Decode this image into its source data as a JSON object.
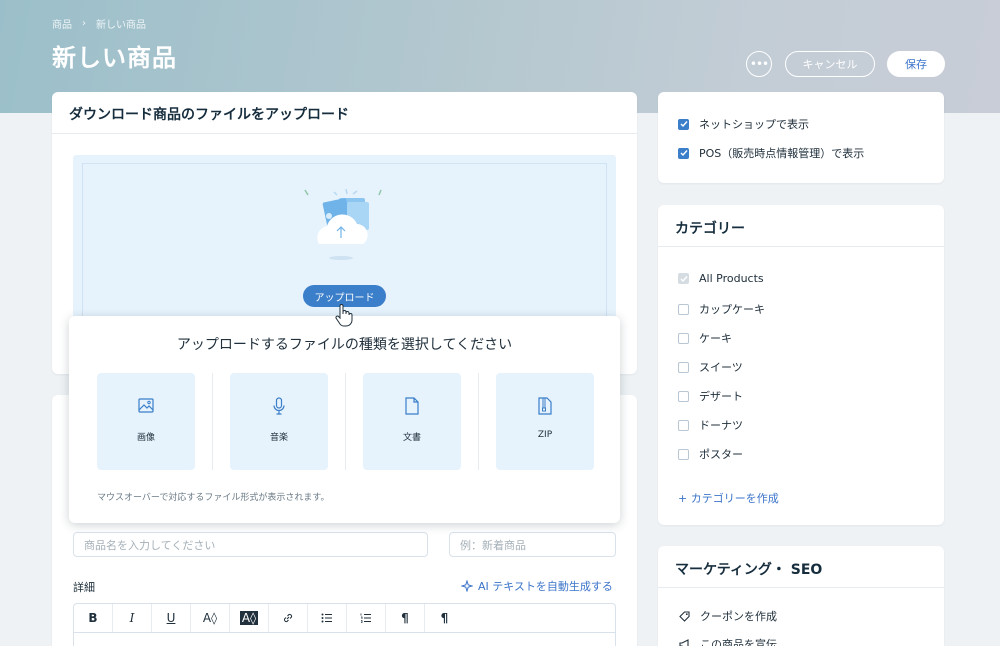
{
  "header": {
    "breadcrumb": [
      "商品",
      "新しい商品"
    ],
    "breadcrumb_sep": "›",
    "title": "新しい商品",
    "more_label": "•••",
    "cancel_label": "キャンセル",
    "save_label": "保存"
  },
  "upload": {
    "title": "ダウンロード商品のファイルをアップロード",
    "button_label": "アップロード"
  },
  "popup": {
    "title": "アップロードするファイルの種類を選択してください",
    "types": [
      {
        "label": "画像",
        "icon": "image-icon"
      },
      {
        "label": "音楽",
        "icon": "microphone-icon"
      },
      {
        "label": "文書",
        "icon": "document-icon"
      },
      {
        "label": "ZIP",
        "icon": "zip-icon"
      }
    ],
    "hint": "マウスオーバーで対応するファイル形式が表示されます。"
  },
  "product_info": {
    "name_placeholder": "商品名を入力してください",
    "ribbon_placeholder": "例：新着商品",
    "description_label": "詳細",
    "ai_label": "AI テキストを自動生成する",
    "toolbar": [
      "B",
      "I",
      "U",
      "A◊",
      "A◊",
      "link",
      "bullets",
      "numbers",
      "ltr",
      "rtl"
    ]
  },
  "visibility": {
    "items": [
      {
        "label": "ネットショップで表示",
        "checked": true
      },
      {
        "label": "POS（販売時点情報管理）で表示",
        "checked": true
      }
    ]
  },
  "categories": {
    "title": "カテゴリー",
    "items": [
      {
        "label": "All Products",
        "state": "disabled"
      },
      {
        "label": "カップケーキ",
        "state": "off"
      },
      {
        "label": "ケーキ",
        "state": "off"
      },
      {
        "label": "スイーツ",
        "state": "off"
      },
      {
        "label": "デザート",
        "state": "off"
      },
      {
        "label": "ドーナツ",
        "state": "off"
      },
      {
        "label": "ポスター",
        "state": "off"
      }
    ],
    "add_label": "+ カテゴリーを作成"
  },
  "marketing": {
    "title": "マーケティング・ SEO",
    "items": [
      {
        "label": "クーポンを作成",
        "icon": "coupon-icon"
      },
      {
        "label": "この商品を宣伝",
        "icon": "megaphone-icon"
      }
    ]
  },
  "colors": {
    "accent": "#3b7ec9",
    "link": "#3b74c9",
    "tile_bg": "#e6f3fd",
    "page_bg": "#eef2f5"
  }
}
